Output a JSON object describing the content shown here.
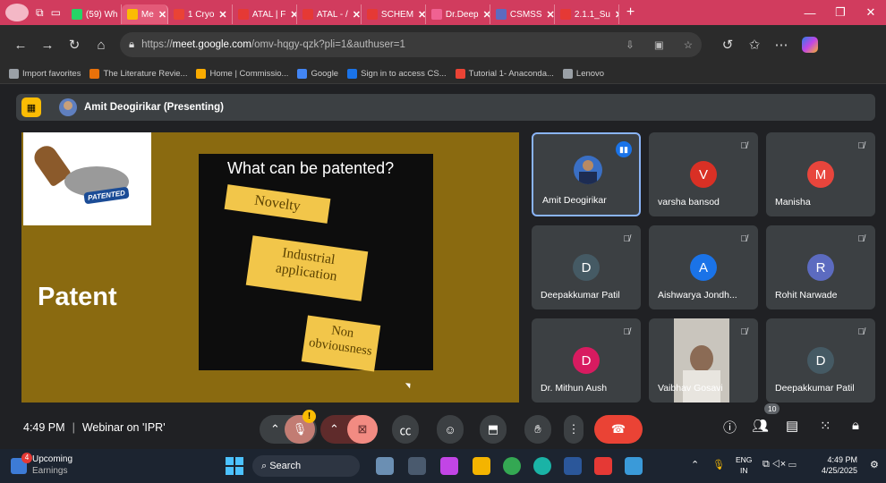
{
  "browser": {
    "tabs": [
      {
        "label": "(59) Wh",
        "color": "#25d366"
      },
      {
        "label": "Me",
        "color": "#fbbc04",
        "active": true
      },
      {
        "label": "1 Cryo",
        "color": "#ea4335"
      },
      {
        "label": "ATAL | F",
        "color": "#e53935"
      },
      {
        "label": "ATAL - /",
        "color": "#e53935"
      },
      {
        "label": "SCHEM",
        "color": "#e53935"
      },
      {
        "label": "Dr.Deep",
        "color": "#f06292"
      },
      {
        "label": "CSMSS",
        "color": "#5c6bc0"
      },
      {
        "label": "2.1.1_Su",
        "color": "#e53935"
      }
    ],
    "new_tab": "+",
    "window_controls": {
      "minimize": "—",
      "restore": "❐",
      "close": "✕"
    },
    "url_prefix": "https://",
    "url_host": "meet.google.com",
    "url_path": "/omv-hqgy-qzk?pli=1&authuser=1",
    "favorites": [
      {
        "label": "Import favorites",
        "color": "#9aa0a6"
      },
      {
        "label": "The Literature Revie...",
        "color": "#e8710a"
      },
      {
        "label": "Home | Commissio...",
        "color": "#f9ab00"
      },
      {
        "label": "Google",
        "color": "#4285f4"
      },
      {
        "label": "Sign in to access CS...",
        "color": "#1a73e8"
      },
      {
        "label": "Tutorial 1- Anaconda...",
        "color": "#ea4335"
      },
      {
        "label": "Lenovo",
        "color": "#9aa0a6"
      }
    ]
  },
  "meet": {
    "presenter_label": "Amit Deogirikar (Presenting)",
    "slide": {
      "title": "Patent",
      "question": "What can be patented?",
      "cards": [
        "Novelty",
        "Industrial application",
        "Non obviousness"
      ],
      "stamp_text": "PATENTED"
    },
    "participants": [
      {
        "name": "Amit Deogirikar",
        "initial": "",
        "color": "#1a73e8",
        "speaking": true
      },
      {
        "name": "varsha bansod",
        "initial": "V",
        "color": "#d93025"
      },
      {
        "name": "Manisha",
        "initial": "M",
        "color": "#e8453c"
      },
      {
        "name": "Deepakkumar Patil",
        "initial": "D",
        "color": "#455a64"
      },
      {
        "name": "Aishwarya Jondh...",
        "initial": "A",
        "color": "#1a73e8"
      },
      {
        "name": "Rohit Narwade",
        "initial": "R",
        "color": "#5c6bc0"
      },
      {
        "name": "Dr. Mithun Aush",
        "initial": "D",
        "color": "#d81b60"
      },
      {
        "name": "Vaibhav Gosavi",
        "initial": "",
        "color": "#ffffff"
      },
      {
        "name": "Deepakkumar Patil",
        "initial": "D",
        "color": "#455a64"
      }
    ],
    "time": "4:49 PM",
    "meeting_title": "Webinar on 'IPR'",
    "people_count": "10",
    "mic_warning": "!"
  },
  "taskbar": {
    "upcoming_title": "Upcoming",
    "upcoming_sub": "Earnings",
    "badge": "4",
    "search_placeholder": "Search",
    "lang_top": "ENG",
    "lang_bottom": "IN",
    "clock_time": "4:49 PM",
    "clock_date": "4/25/2025"
  }
}
